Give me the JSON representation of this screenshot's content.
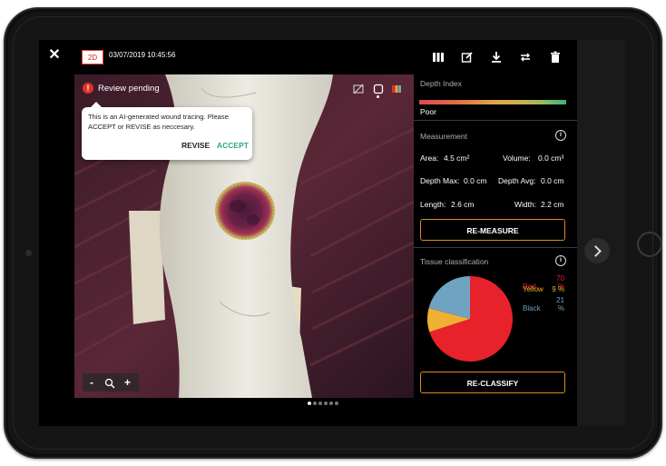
{
  "header": {
    "mode_badge": "2D",
    "datetime": "03/07/2019 10:45:56",
    "toolbar_icons": [
      "columns-icon",
      "edit-icon",
      "download-icon",
      "swap-icon",
      "trash-icon"
    ]
  },
  "photo": {
    "review_status": "Review pending",
    "popover": {
      "message": "This is an AI-generated wound tracing. Please ACCEPT or REVISE as neccesary.",
      "revise_label": "REVISE",
      "accept_label": "ACCEPT"
    },
    "zoom": {
      "minus": "-",
      "plus": "+"
    },
    "page_count": 6,
    "active_page": 1
  },
  "panel": {
    "depth_index": {
      "title": "Depth Index",
      "value": "Poor"
    },
    "measurement": {
      "title": "Measurement",
      "area_label": "Area:",
      "area_value": "4.5 cm²",
      "volume_label": "Volume:",
      "volume_value": "0.0 cm³",
      "depth_max_label": "Depth Max:",
      "depth_max_value": "0.0 cm",
      "depth_avg_label": "Depth Avg:",
      "depth_avg_value": "0.0 cm",
      "length_label": "Length:",
      "length_value": "2.6 cm",
      "width_label": "Width:",
      "width_value": "2.2 cm",
      "remeasure_label": "RE-MEASURE"
    },
    "tissue": {
      "title": "Tissue classification",
      "items": [
        {
          "name": "Red",
          "value": "70 %",
          "percent": 70,
          "color": "#e8222a"
        },
        {
          "name": "Yellow",
          "value": "9 %",
          "percent": 9,
          "color": "#f0b032"
        },
        {
          "name": "Black",
          "value": "21 %",
          "percent": 21,
          "color": "#6fa3c2"
        }
      ],
      "reclassify_label": "RE-CLASSIFY"
    }
  },
  "colors": {
    "accent": "#2ea58a",
    "button_border": "#d98a1f",
    "alert": "#e0312b"
  }
}
